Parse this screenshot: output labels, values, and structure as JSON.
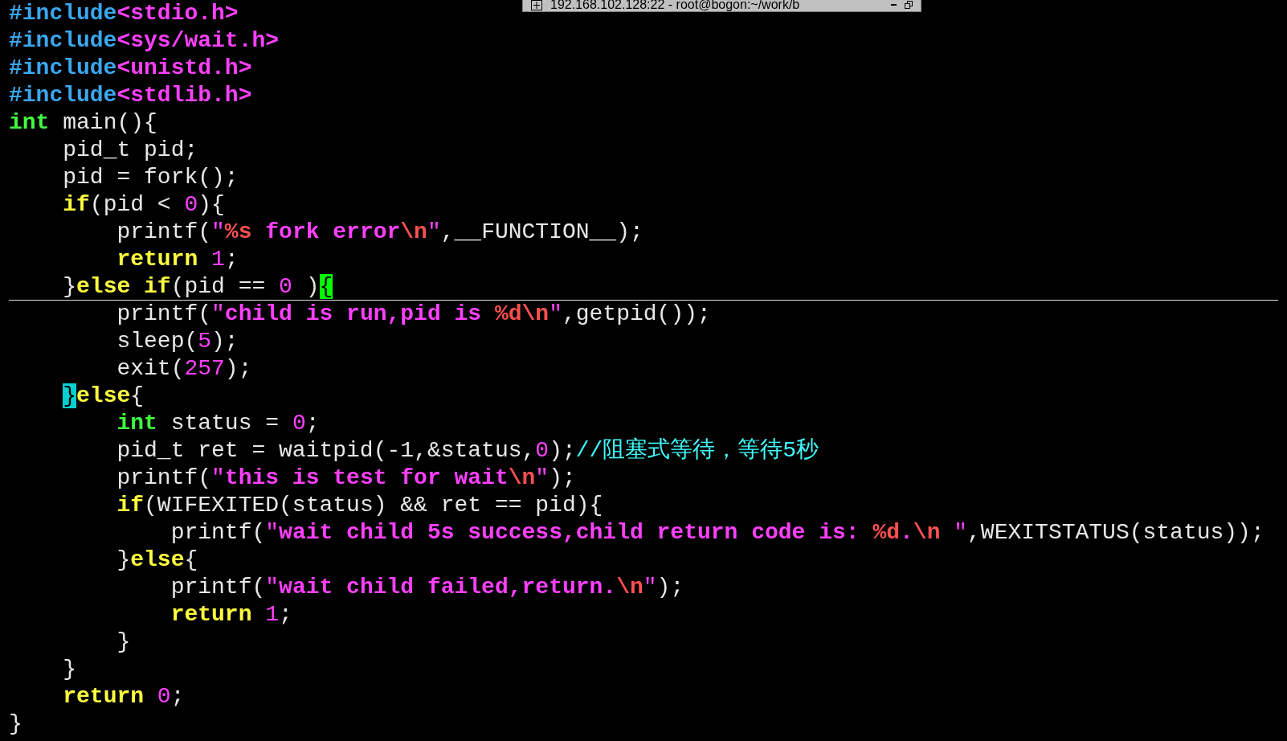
{
  "window": {
    "title": "192.168.102.128:22 - root@bogon:~/work/b"
  },
  "editor": {
    "lines": [
      {
        "cursor_line": false,
        "tokens": [
          {
            "kind": "preproc",
            "text": "#include"
          },
          {
            "kind": "include",
            "text": "<stdio.h>"
          }
        ]
      },
      {
        "cursor_line": false,
        "tokens": [
          {
            "kind": "preproc",
            "text": "#include"
          },
          {
            "kind": "include",
            "text": "<sys/wait.h>"
          }
        ]
      },
      {
        "cursor_line": false,
        "tokens": [
          {
            "kind": "preproc",
            "text": "#include"
          },
          {
            "kind": "include",
            "text": "<unistd.h>"
          }
        ]
      },
      {
        "cursor_line": false,
        "tokens": [
          {
            "kind": "preproc",
            "text": "#include"
          },
          {
            "kind": "include",
            "text": "<stdlib.h>"
          }
        ]
      },
      {
        "cursor_line": false,
        "tokens": [
          {
            "kind": "type",
            "text": "int"
          },
          {
            "kind": "plain",
            "text": " main(){"
          }
        ]
      },
      {
        "cursor_line": false,
        "tokens": [
          {
            "kind": "plain",
            "text": "    pid_t pid;"
          }
        ]
      },
      {
        "cursor_line": false,
        "tokens": [
          {
            "kind": "plain",
            "text": "    pid = fork();"
          }
        ]
      },
      {
        "cursor_line": false,
        "tokens": [
          {
            "kind": "keyword",
            "text": "    if"
          },
          {
            "kind": "plain",
            "text": "(pid < "
          },
          {
            "kind": "number",
            "text": "0"
          },
          {
            "kind": "plain",
            "text": "){"
          }
        ]
      },
      {
        "cursor_line": false,
        "tokens": [
          {
            "kind": "plain",
            "text": "        printf("
          },
          {
            "kind": "quote",
            "text": "\""
          },
          {
            "kind": "special",
            "text": "%s"
          },
          {
            "kind": "string",
            "text": " fork error"
          },
          {
            "kind": "special",
            "text": "\\n"
          },
          {
            "kind": "quote",
            "text": "\""
          },
          {
            "kind": "plain",
            "text": ",__FUNCTION__);"
          }
        ]
      },
      {
        "cursor_line": false,
        "tokens": [
          {
            "kind": "keyword",
            "text": "        return"
          },
          {
            "kind": "number",
            "text": " 1"
          },
          {
            "kind": "plain",
            "text": ";"
          }
        ]
      },
      {
        "cursor_line": true,
        "tokens": [
          {
            "kind": "plain",
            "text": "    }"
          },
          {
            "kind": "keyword",
            "text": "else if"
          },
          {
            "kind": "plain",
            "text": "(pid == "
          },
          {
            "kind": "number",
            "text": "0"
          },
          {
            "kind": "plain",
            "text": " )"
          },
          {
            "kind": "cursor",
            "text": "{"
          }
        ]
      },
      {
        "cursor_line": false,
        "tokens": [
          {
            "kind": "plain",
            "text": "        printf("
          },
          {
            "kind": "quote",
            "text": "\""
          },
          {
            "kind": "string",
            "text": "child is run,pid is "
          },
          {
            "kind": "special",
            "text": "%d\\n"
          },
          {
            "kind": "quote",
            "text": "\""
          },
          {
            "kind": "plain",
            "text": ",getpid());"
          }
        ]
      },
      {
        "cursor_line": false,
        "tokens": [
          {
            "kind": "plain",
            "text": "        sleep("
          },
          {
            "kind": "number",
            "text": "5"
          },
          {
            "kind": "plain",
            "text": ");"
          }
        ]
      },
      {
        "cursor_line": false,
        "tokens": [
          {
            "kind": "plain",
            "text": "        exit("
          },
          {
            "kind": "number",
            "text": "257"
          },
          {
            "kind": "plain",
            "text": ");"
          }
        ]
      },
      {
        "cursor_line": false,
        "tokens": [
          {
            "kind": "match",
            "text": "    }"
          },
          {
            "kind": "keyword",
            "text": "else"
          },
          {
            "kind": "plain",
            "text": "{"
          }
        ]
      },
      {
        "cursor_line": false,
        "tokens": [
          {
            "kind": "type",
            "text": "        int"
          },
          {
            "kind": "plain",
            "text": " status = "
          },
          {
            "kind": "number",
            "text": "0"
          },
          {
            "kind": "plain",
            "text": ";"
          }
        ]
      },
      {
        "cursor_line": false,
        "tokens": [
          {
            "kind": "plain",
            "text": "        pid_t ret = waitpid(-1,&status,"
          },
          {
            "kind": "number",
            "text": "0"
          },
          {
            "kind": "plain",
            "text": ");"
          },
          {
            "kind": "comment",
            "text": "//阻塞式等待，等待5秒"
          }
        ]
      },
      {
        "cursor_line": false,
        "tokens": [
          {
            "kind": "plain",
            "text": "        printf("
          },
          {
            "kind": "quote",
            "text": "\""
          },
          {
            "kind": "string",
            "text": "this is test for wait"
          },
          {
            "kind": "special",
            "text": "\\n"
          },
          {
            "kind": "quote",
            "text": "\""
          },
          {
            "kind": "plain",
            "text": ");"
          }
        ]
      },
      {
        "cursor_line": false,
        "tokens": [
          {
            "kind": "keyword",
            "text": "        if"
          },
          {
            "kind": "plain",
            "text": "(WIFEXITED(status) && ret == pid){"
          }
        ]
      },
      {
        "cursor_line": false,
        "tokens": [
          {
            "kind": "plain",
            "text": "            printf("
          },
          {
            "kind": "quote",
            "text": "\""
          },
          {
            "kind": "string",
            "text": "wait child 5s success,child return code is: "
          },
          {
            "kind": "special",
            "text": "%d"
          },
          {
            "kind": "string",
            "text": "."
          },
          {
            "kind": "special",
            "text": "\\n "
          },
          {
            "kind": "quote",
            "text": "\""
          },
          {
            "kind": "plain",
            "text": ",WEXITSTATUS(status));"
          }
        ]
      },
      {
        "cursor_line": false,
        "tokens": [
          {
            "kind": "plain",
            "text": "        }"
          },
          {
            "kind": "keyword",
            "text": "else"
          },
          {
            "kind": "plain",
            "text": "{"
          }
        ]
      },
      {
        "cursor_line": false,
        "tokens": [
          {
            "kind": "plain",
            "text": "            printf("
          },
          {
            "kind": "quote",
            "text": "\""
          },
          {
            "kind": "string",
            "text": "wait child failed,return."
          },
          {
            "kind": "special",
            "text": "\\n"
          },
          {
            "kind": "quote",
            "text": "\""
          },
          {
            "kind": "plain",
            "text": ");"
          }
        ]
      },
      {
        "cursor_line": false,
        "tokens": [
          {
            "kind": "keyword",
            "text": "            return"
          },
          {
            "kind": "number",
            "text": " 1"
          },
          {
            "kind": "plain",
            "text": ";"
          }
        ]
      },
      {
        "cursor_line": false,
        "tokens": [
          {
            "kind": "plain",
            "text": "        }"
          }
        ]
      },
      {
        "cursor_line": false,
        "tokens": [
          {
            "kind": "plain",
            "text": "    }"
          }
        ]
      },
      {
        "cursor_line": false,
        "tokens": [
          {
            "kind": "keyword",
            "text": "    return"
          },
          {
            "kind": "number",
            "text": " 0"
          },
          {
            "kind": "plain",
            "text": ";"
          }
        ]
      },
      {
        "cursor_line": false,
        "tokens": [
          {
            "kind": "plain",
            "text": "}"
          }
        ]
      }
    ]
  }
}
